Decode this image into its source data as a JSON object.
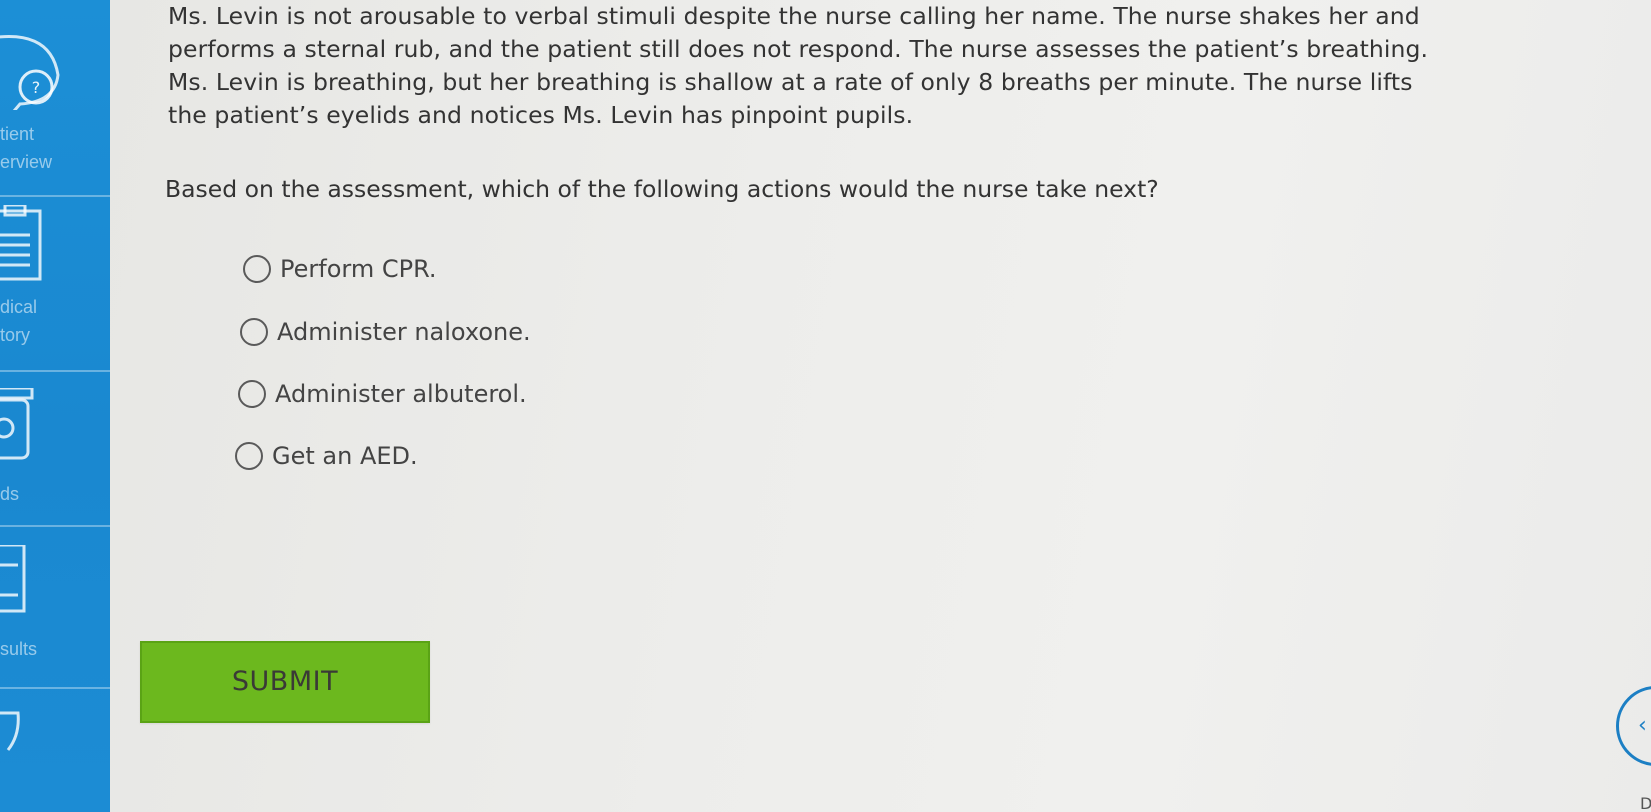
{
  "sidebar": {
    "items": [
      {
        "label": "tient\nerview",
        "icon": "help-bubble-icon"
      },
      {
        "label": "dical\ntory",
        "icon": "clipboard-icon"
      },
      {
        "label": "ds",
        "icon": "medication-jar-icon"
      },
      {
        "label": "sults",
        "icon": "report-icon"
      },
      {
        "label": "",
        "icon": "partial-icon"
      }
    ]
  },
  "question": {
    "passage_lines": [
      "Ms. Levin is not arousable to verbal stimuli despite the nurse calling her name. The nurse shakes her and",
      "performs a sternal rub, and the patient still does not respond. The nurse assesses the patient’s breathing.",
      "Ms. Levin is breathing, but her breathing is shallow at a rate of only 8 breaths per minute. The nurse lifts",
      "the patient’s eyelids and notices Ms. Levin has pinpoint pupils."
    ],
    "prompt": "Based on the assessment, which of the following actions would the nurse take next?",
    "options": [
      "Perform CPR.",
      "Administer naloxone.",
      "Administer albuterol.",
      "Get an AED."
    ]
  },
  "actions": {
    "submit_label": "SUBMIT"
  },
  "corner": {
    "glyph": "‹",
    "letter": "D"
  },
  "colors": {
    "sidebar": "#1c8fd6",
    "submit": "#6cb81e",
    "accent": "#1c7fc4"
  }
}
